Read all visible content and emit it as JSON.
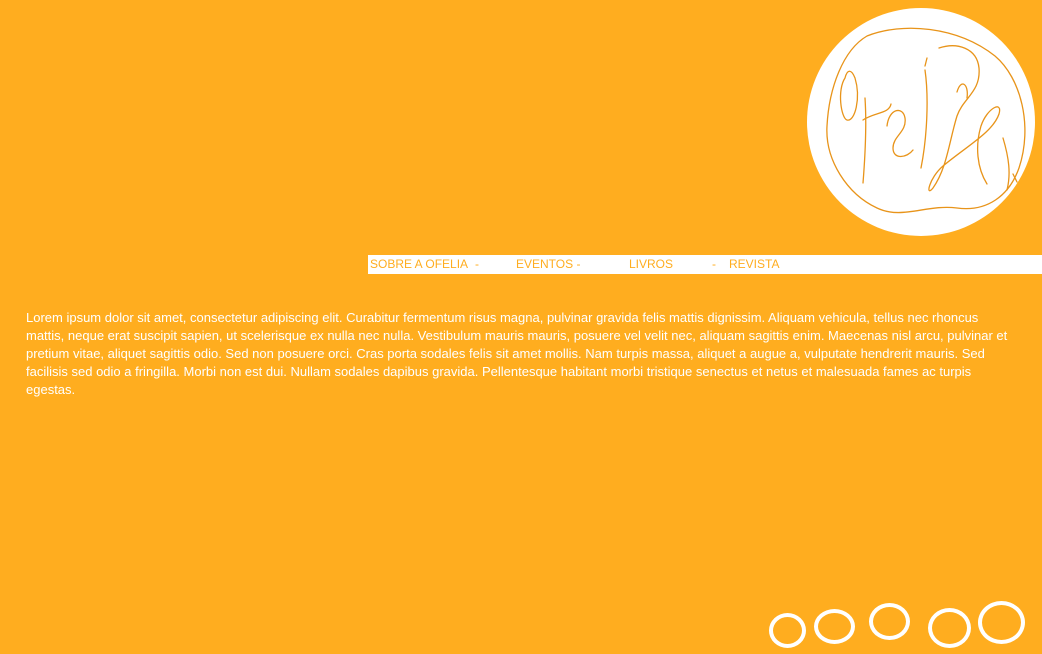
{
  "colors": {
    "background": "#ffad1f",
    "accent": "#ffad1f",
    "surface": "#ffffff"
  },
  "logo": {
    "icon": "signature-logo-icon"
  },
  "nav": {
    "items": [
      {
        "label": "SOBRE A OFELIA"
      },
      {
        "label": "EVENTOS -"
      },
      {
        "label": "LIVROS"
      },
      {
        "label": "REVISTA"
      }
    ],
    "separator": "-"
  },
  "main": {
    "text": "Lorem ipsum dolor sit amet, consectetur adipiscing elit. Curabitur fermentum risus magna, pulvinar gravida felis mattis dignissim. Aliquam vehicula, tellus nec rhoncus mattis, neque erat suscipit sapien, ut scelerisque ex nulla nec nulla. Vestibulum mauris mauris, posuere vel velit nec, aliquam sagittis enim. Maecenas nisl arcu, pulvinar et pretium vitae, aliquet sagittis odio. Sed non posuere orci. Cras porta sodales felis sit amet mollis. Nam turpis massa, aliquet a augue a, vulputate hendrerit mauris. Sed facilisis sed odio a fringilla. Morbi non est dui. Nullam sodales dapibus gravida. Pellentesque habitant morbi tristique senectus et netus et malesuada fames ac turpis egestas."
  },
  "footer": {
    "rings": [
      {
        "icon": "circle-icon"
      },
      {
        "icon": "circle-icon"
      },
      {
        "icon": "circle-icon"
      },
      {
        "icon": "circle-icon"
      },
      {
        "icon": "circle-icon"
      }
    ]
  }
}
